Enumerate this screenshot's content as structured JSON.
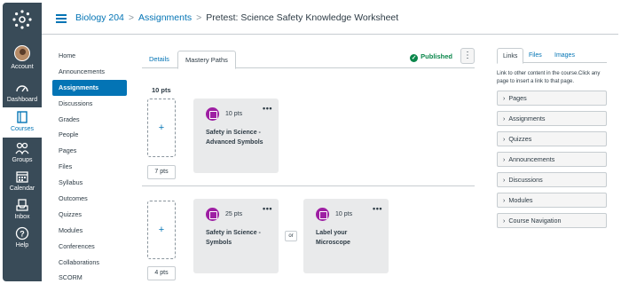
{
  "global_nav": {
    "items": [
      {
        "label": "Account",
        "icon": "avatar"
      },
      {
        "label": "Dashboard",
        "icon": "dashboard-icon"
      },
      {
        "label": "Courses",
        "icon": "book-icon"
      },
      {
        "label": "Groups",
        "icon": "groups-icon"
      },
      {
        "label": "Calendar",
        "icon": "calendar-icon"
      },
      {
        "label": "Inbox",
        "icon": "inbox-icon"
      },
      {
        "label": "Help",
        "icon": "help-icon"
      }
    ],
    "active": "Courses"
  },
  "breadcrumb": {
    "course": "Biology 204",
    "section": "Assignments",
    "current": "Pretest: Science Safety Knowledge Worksheet",
    "separator": ">"
  },
  "course_nav": {
    "items": [
      "Home",
      "Announcements",
      "Assignments",
      "Discussions",
      "Grades",
      "People",
      "Pages",
      "Files",
      "Syllabus",
      "Outcomes",
      "Quizzes",
      "Modules",
      "Conferences",
      "Collaborations",
      "SCORM"
    ],
    "active": "Assignments"
  },
  "main": {
    "tabs": [
      "Details",
      "Mastery Paths"
    ],
    "active_tab": "Mastery Paths",
    "status": "Published",
    "header_pts": "10 pts",
    "range1": {
      "pts": "7 pts",
      "cards": [
        {
          "pts": "10 pts",
          "title": "Safety in Science - Advanced Symbols"
        }
      ]
    },
    "range2": {
      "pts": "4 pts",
      "or_label": "or",
      "cards": [
        {
          "pts": "25 pts",
          "title": "Safety in Science - Symbols"
        },
        {
          "pts": "10 pts",
          "title": "Label your Microscope"
        }
      ]
    },
    "add_symbol": "+",
    "more_symbol": "•••",
    "kebab_symbol": "⋮"
  },
  "sidebar": {
    "tabs": [
      "Links",
      "Files",
      "Images"
    ],
    "active_tab": "Links",
    "description": "Link to other content in the course.Click any page to insert a link to that page.",
    "sections": [
      "Pages",
      "Assignments",
      "Quizzes",
      "Announcements",
      "Discussions",
      "Modules",
      "Course Navigation"
    ]
  },
  "colors": {
    "nav_bg": "#394b58",
    "link": "#0374b5",
    "published": "#0b874b",
    "badge": "#9e1fa3",
    "card_bg": "#e9eaeb"
  }
}
